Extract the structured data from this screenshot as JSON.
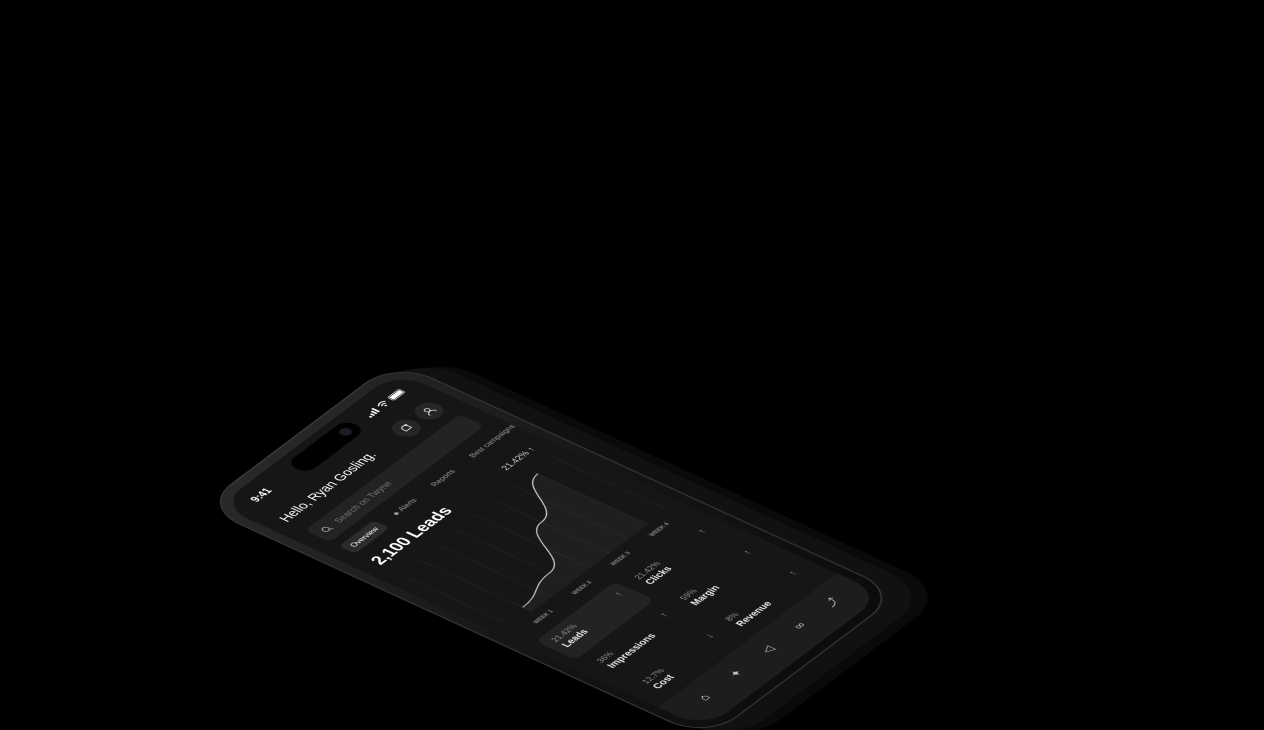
{
  "status": {
    "time": "9:41"
  },
  "header": {
    "greeting": "Hello, Ryan Gosling."
  },
  "search": {
    "placeholder": "Search on Twyne"
  },
  "tabs": [
    {
      "label": "Overview"
    },
    {
      "label": "Alerts"
    },
    {
      "label": "Reports"
    },
    {
      "label": "Best campaigns"
    }
  ],
  "summary": {
    "headline": "2,100 Leads",
    "change": "21.42%"
  },
  "chart_data": {
    "type": "line",
    "categories": [
      "WEEK 1",
      "WEEK 2",
      "WEEK 3",
      "WEEK 4"
    ],
    "series": [
      {
        "values": [
          8,
          18,
          58,
          94
        ]
      }
    ],
    "ylim": [
      0,
      100
    ],
    "grid": true
  },
  "metrics": [
    {
      "value": "21.42%",
      "name": "Leads",
      "trend": "up"
    },
    {
      "value": "21.42%",
      "name": "Clicks",
      "trend": "up"
    },
    {
      "value": "36%",
      "name": "Impressions",
      "trend": "up"
    },
    {
      "value": "59%",
      "name": "Margin",
      "trend": "up"
    },
    {
      "value": "12.7%",
      "name": "Cost",
      "trend": "down"
    },
    {
      "value": "8%",
      "name": "Revenue",
      "trend": "up"
    }
  ],
  "nav": [
    "home-icon",
    "rocket-icon",
    "megaphone-icon",
    "glasses-icon",
    "trend-icon"
  ]
}
